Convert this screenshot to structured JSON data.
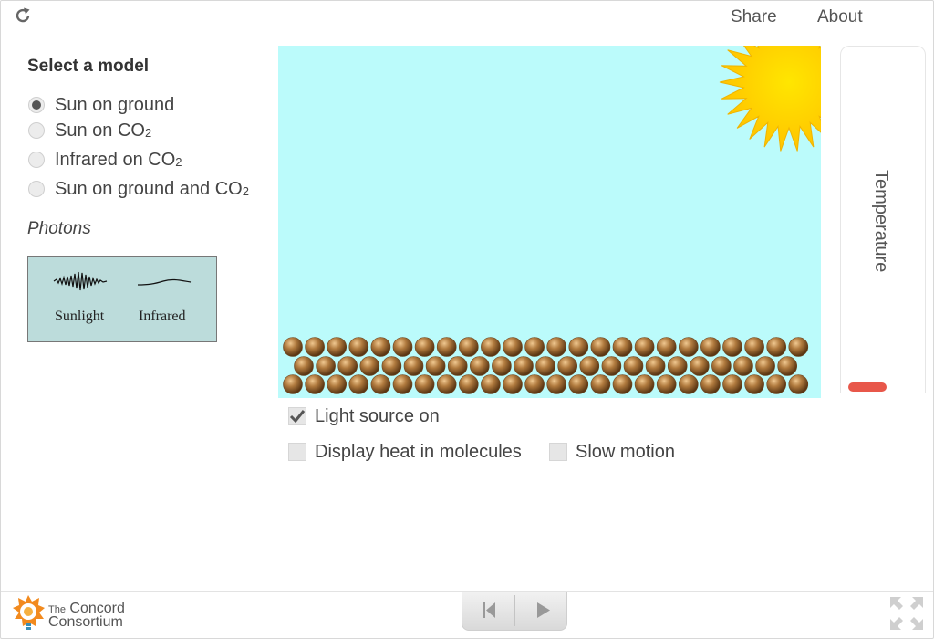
{
  "header": {
    "reload_icon": "reload-icon",
    "share_label": "Share",
    "about_label": "About"
  },
  "model_select": {
    "title": "Select a model",
    "options": [
      {
        "label": "Sun on ground",
        "sub": "",
        "selected": true
      },
      {
        "label": "Sun on CO",
        "sub": "2",
        "selected": false
      },
      {
        "label": "Infrared on CO",
        "sub": "2",
        "selected": false
      },
      {
        "label": "Sun on ground and CO",
        "sub": "2",
        "selected": false
      }
    ]
  },
  "photons": {
    "title": "Photons",
    "sunlight_label": "Sunlight",
    "infrared_label": "Infrared"
  },
  "simulation": {
    "background_color": "#bbfbfb",
    "sun_icon": "sun-icon",
    "ground_molecule_color": "#8b5a2b"
  },
  "thermometer": {
    "label": "Temperature",
    "bar_color": "#e8574a"
  },
  "controls": {
    "light_source_label": "Light source on",
    "light_source_checked": true,
    "display_heat_label": "Display heat in molecules",
    "display_heat_checked": false,
    "slow_motion_label": "Slow motion",
    "slow_motion_checked": false
  },
  "footer": {
    "logo_the": "The",
    "logo_line1": "Concord",
    "logo_line2": "Consortium",
    "reset_icon": "skip-to-start-icon",
    "play_icon": "play-icon",
    "fullscreen_icon": "fullscreen-icon"
  }
}
